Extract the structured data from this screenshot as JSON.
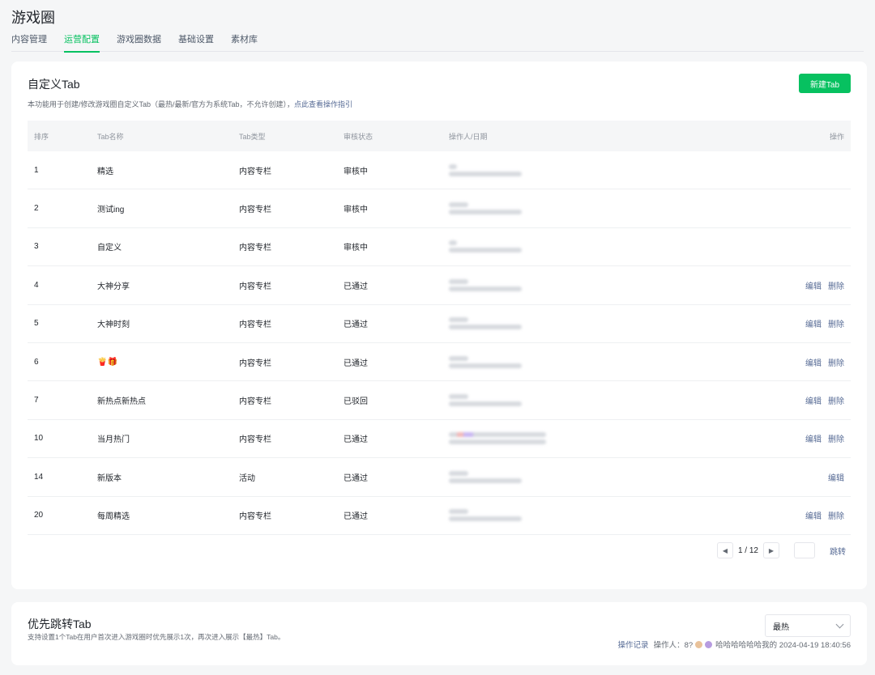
{
  "page": {
    "title": "游戏圈"
  },
  "nav": {
    "tabs": [
      {
        "label": "内容管理"
      },
      {
        "label": "运营配置",
        "active": true
      },
      {
        "label": "游戏圈数据"
      },
      {
        "label": "基础设置"
      },
      {
        "label": "素材库"
      }
    ]
  },
  "custom_tab": {
    "title": "自定义Tab",
    "description": "本功能用于创建/修改游戏圈自定义Tab（最热/最新/官方为系统Tab，不允许创建），",
    "guide_link": "点此查看操作指引",
    "new_button": "新建Tab"
  },
  "table": {
    "headers": {
      "rank": "排序",
      "name": "Tab名称",
      "type": "Tab类型",
      "status": "审核状态",
      "operator": "操作人/日期",
      "action": "操作"
    },
    "rows": [
      {
        "rank": "1",
        "name": "精选",
        "type": "内容专栏",
        "status": "审核中",
        "actions": []
      },
      {
        "rank": "2",
        "name": "测试ing",
        "type": "内容专栏",
        "status": "审核中",
        "actions": []
      },
      {
        "rank": "3",
        "name": "自定义",
        "type": "内容专栏",
        "status": "审核中",
        "actions": []
      },
      {
        "rank": "4",
        "name": "大神分享",
        "type": "内容专栏",
        "status": "已通过",
        "actions": [
          "编辑",
          "删除"
        ]
      },
      {
        "rank": "5",
        "name": "大神时刻",
        "type": "内容专栏",
        "status": "已通过",
        "actions": [
          "编辑",
          "删除"
        ]
      },
      {
        "rank": "6",
        "name": "🍟🎁",
        "type": "内容专栏",
        "status": "已通过",
        "actions": [
          "编辑",
          "删除"
        ]
      },
      {
        "rank": "7",
        "name": "新热点新热点",
        "type": "内容专栏",
        "status": "已驳回",
        "actions": [
          "编辑",
          "删除"
        ]
      },
      {
        "rank": "10",
        "name": "当月热门",
        "type": "内容专栏",
        "status": "已通过",
        "actions": [
          "编辑",
          "删除"
        ]
      },
      {
        "rank": "14",
        "name": "新版本",
        "type": "活动",
        "status": "已通过",
        "actions": [
          "编辑"
        ]
      },
      {
        "rank": "20",
        "name": "每周精选",
        "type": "内容专栏",
        "status": "已通过",
        "actions": [
          "编辑",
          "删除"
        ]
      }
    ]
  },
  "pagination": {
    "current": "1 / 12",
    "jump_label": "跳转"
  },
  "priority_tab": {
    "title": "优先跳转Tab",
    "description": "支持设置1个Tab在用户首次进入游戏圈时优先展示1次，再次进入展示【最热】Tab。",
    "selected": "最热",
    "log_link": "操作记录",
    "operator_prefix": "操作人：8?",
    "operator_suffix": "哈哈哈哈哈哈我的 2024-04-19 18:40:56"
  }
}
